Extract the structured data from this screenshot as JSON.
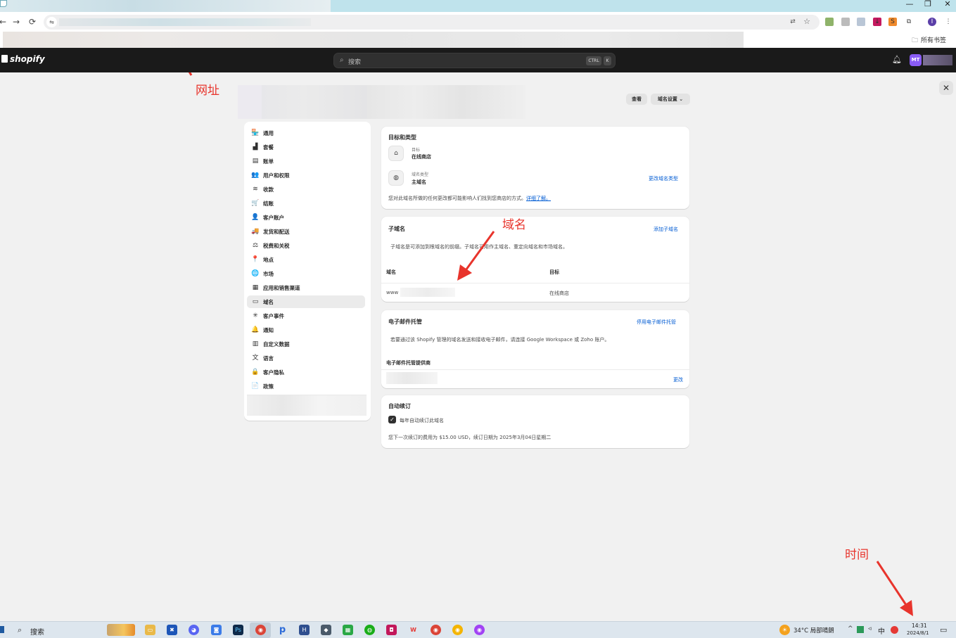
{
  "browser": {
    "window_controls": [
      "—",
      "❐",
      "✕"
    ],
    "nav_icons": [
      "back-icon",
      "forward-icon",
      "reload-icon"
    ],
    "all_bookmarks": "所有书签"
  },
  "topbar": {
    "logo": "shopify",
    "search_placeholder": "搜索",
    "shortcut_keys": [
      "CTRL",
      "K"
    ],
    "avatar_initials": "MT"
  },
  "header": {
    "view_button": "查看",
    "domain_settings_button": "域名设置"
  },
  "nav": {
    "items": [
      {
        "label": "通用",
        "icon": "store-icon",
        "glyph": "🏪"
      },
      {
        "label": "套餐",
        "icon": "plan-icon",
        "glyph": "▟"
      },
      {
        "label": "账单",
        "icon": "billing-icon",
        "glyph": "▤"
      },
      {
        "label": "用户和权限",
        "icon": "users-icon",
        "glyph": "👥"
      },
      {
        "label": "收款",
        "icon": "payments-icon",
        "glyph": "≋"
      },
      {
        "label": "结账",
        "icon": "cart-icon",
        "glyph": "🛒"
      },
      {
        "label": "客户账户",
        "icon": "person-icon",
        "glyph": "👤"
      },
      {
        "label": "发货和配送",
        "icon": "truck-icon",
        "glyph": "🚚"
      },
      {
        "label": "税费和关税",
        "icon": "tax-icon",
        "glyph": "⚖"
      },
      {
        "label": "地点",
        "icon": "location-icon",
        "glyph": "📍"
      },
      {
        "label": "市场",
        "icon": "globe-icon",
        "glyph": "🌐"
      },
      {
        "label": "应用和销售渠道",
        "icon": "apps-icon",
        "glyph": "▦"
      },
      {
        "label": "域名",
        "icon": "domain-icon",
        "glyph": "▭"
      },
      {
        "label": "客户事件",
        "icon": "events-icon",
        "glyph": "✳"
      },
      {
        "label": "通知",
        "icon": "bell-icon",
        "glyph": "🔔"
      },
      {
        "label": "自定义数据",
        "icon": "data-icon",
        "glyph": "▥"
      },
      {
        "label": "语言",
        "icon": "language-icon",
        "glyph": "文"
      },
      {
        "label": "客户隐私",
        "icon": "lock-icon",
        "glyph": "🔒"
      },
      {
        "label": "政策",
        "icon": "policy-icon",
        "glyph": "📄"
      }
    ],
    "active_index": 12
  },
  "target_card": {
    "title": "目标和类型",
    "target_label": "目标",
    "target_value": "在线商店",
    "type_label": "域名类型",
    "type_value": "主域名",
    "change_type_link": "更改域名类型",
    "note": "您对此域名所做的任何更改都可能影响人们找到您商店的方式。",
    "learn_more": "详细了解。"
  },
  "subdomain_card": {
    "title": "子域名",
    "add_link": "添加子域名",
    "description": "子域名是可添加到根域名的前缀。子域名可用作主域名、重定向域名和市场域名。",
    "col_domain": "域名",
    "col_target": "目标",
    "row_domain_prefix": "www",
    "row_target": "在线商店"
  },
  "email_card": {
    "title": "电子邮件托管",
    "disable_link": "停用电子邮件托管",
    "description": "若要通过该 Shopify 管理的域名发送和接收电子邮件，请连接 Google Workspace 或 Zoho 账户。",
    "provider_label": "电子邮件托管提供商",
    "change_link": "更改"
  },
  "renew_card": {
    "title": "自动续订",
    "checkbox_label": "每年自动续订此域名",
    "checked": true,
    "note": "您下一次续订的费用为 $15.00 USD，续订日期为 2025年3月04日星期二"
  },
  "annotations": {
    "url": "网址",
    "domain": "域名",
    "time": "时间"
  },
  "taskbar": {
    "search": "搜索",
    "weather": "34°C 局部晴朗",
    "ime": "中",
    "time": "14:31",
    "date": "2024/8/1"
  },
  "colors": {
    "topbar": "#1a1a1a",
    "link": "#005bd3",
    "annotation": "#e8342c",
    "avatar": "#8a5cf6"
  }
}
